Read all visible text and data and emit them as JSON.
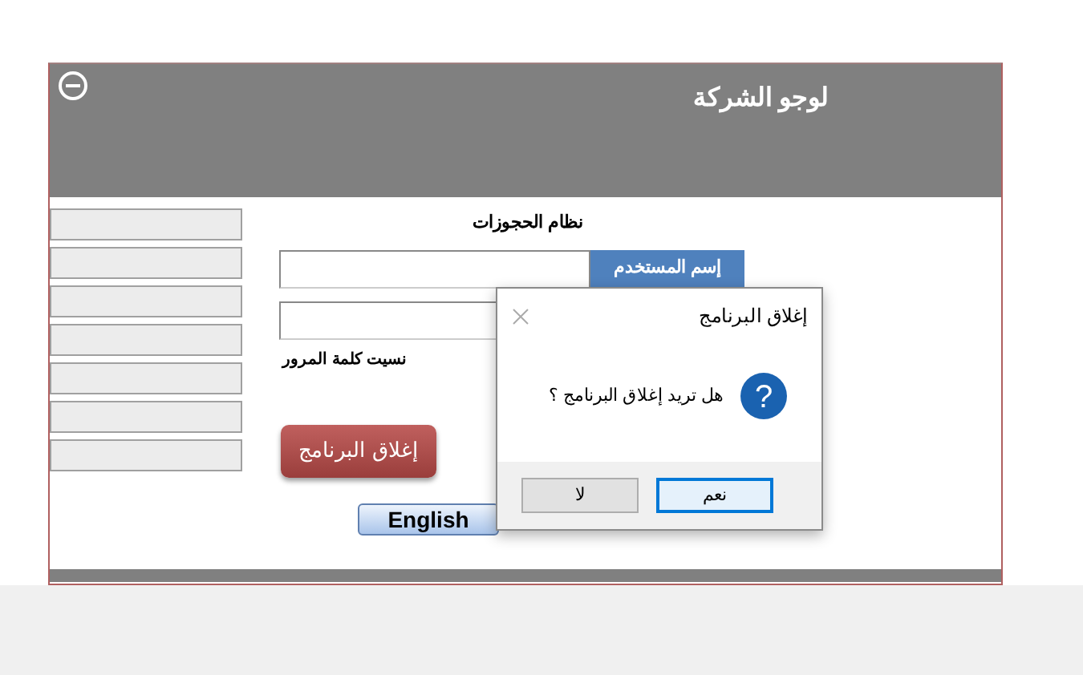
{
  "header": {
    "logo_text": "لوجو الشركة"
  },
  "form": {
    "title": "نظام الحجوزات",
    "username_label": "إسم المستخدم",
    "forgot_password": "نسيت كلمة المرور",
    "close_button": "إغلاق البرنامج",
    "language_button": "English"
  },
  "dialog": {
    "title": "إغلاق البرنامج",
    "message": "هل تريد إغلاق البرنامج ؟",
    "icon": "?",
    "buttons": [
      {
        "label": "نعم",
        "selected": true
      },
      {
        "label": "لا",
        "selected": false
      }
    ]
  }
}
